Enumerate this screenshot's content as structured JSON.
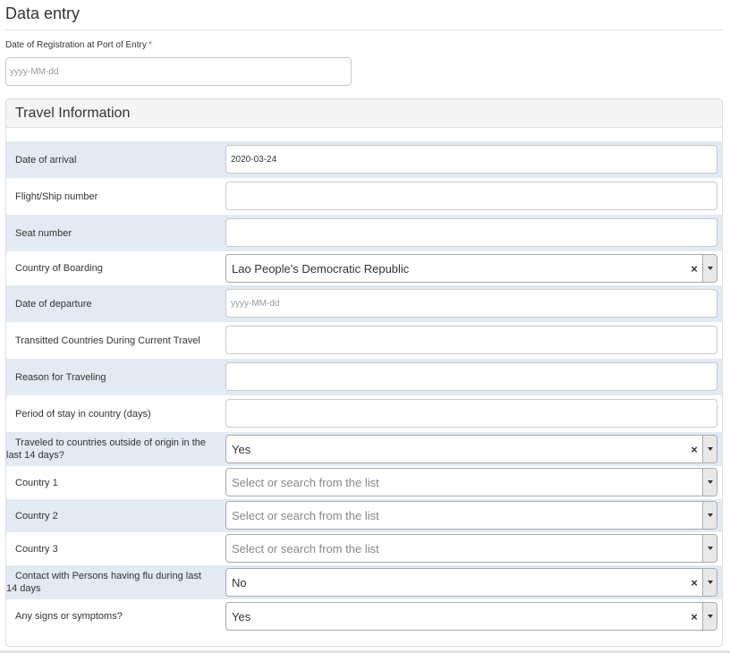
{
  "page": {
    "title": "Data entry"
  },
  "registration": {
    "label": "Date of Registration at Port of Entry",
    "required_mark": "*",
    "placeholder": "yyyy-MM-dd",
    "value": ""
  },
  "panel": {
    "title": "Travel Information",
    "fields": {
      "date_of_arrival": {
        "label": "Date of arrival",
        "value": "2020-03-24"
      },
      "flight_number": {
        "label": "Flight/Ship number",
        "value": ""
      },
      "seat_number": {
        "label": "Seat number",
        "value": ""
      },
      "country_of_boarding": {
        "label": "Country of Boarding",
        "value": "Lao People's Democratic Republic"
      },
      "date_of_departure": {
        "label": "Date of departure",
        "placeholder": "yyyy-MM-dd",
        "value": ""
      },
      "transitted_countries": {
        "label": "Transitted Countries During Current Travel",
        "value": ""
      },
      "reason_for_traveling": {
        "label": "Reason for Traveling",
        "value": ""
      },
      "period_of_stay": {
        "label": "Period of stay in country (days)",
        "value": ""
      },
      "traveled_outside": {
        "label_line1": "Traveled to countries outside of origin in the",
        "label_line2": "last 14 days?",
        "value": "Yes"
      },
      "country_1": {
        "label": "Country 1",
        "placeholder": "Select or search from the list"
      },
      "country_2": {
        "label": "Country 2",
        "placeholder": "Select or search from the list"
      },
      "country_3": {
        "label": "Country 3",
        "placeholder": "Select or search from the list"
      },
      "contact_flu": {
        "label_line1": "Contact with Persons having flu during last",
        "label_line2": "14 days",
        "value": "No"
      },
      "signs_symptoms": {
        "label": "Any signs or symptoms?",
        "value": "Yes"
      }
    }
  },
  "icons": {
    "clear": "×",
    "dropdown": "chevron-down-icon"
  }
}
